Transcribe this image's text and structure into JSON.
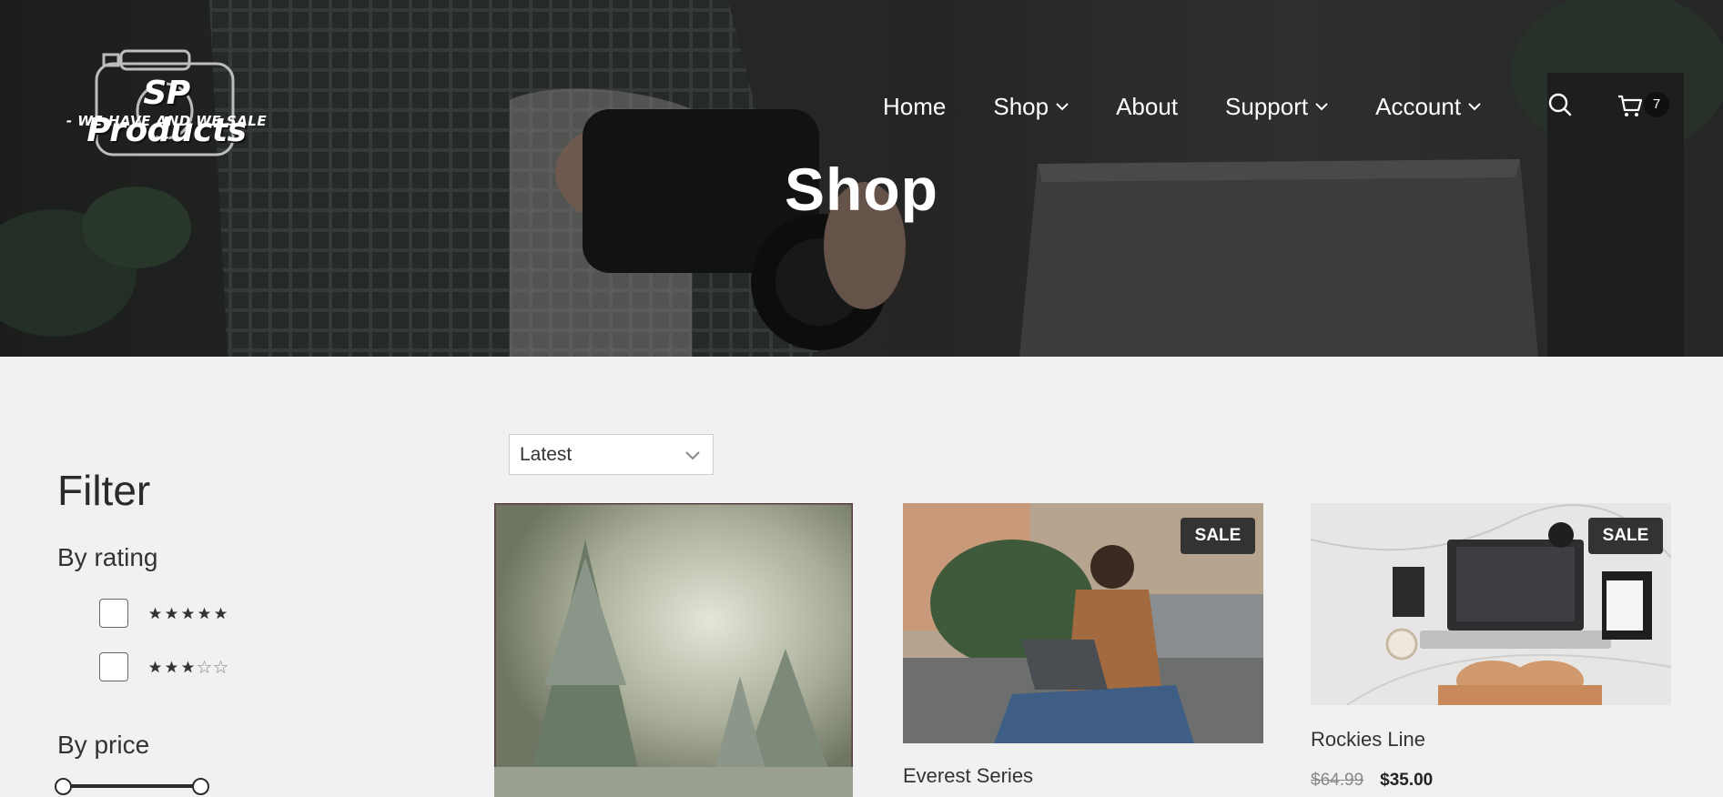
{
  "brand": {
    "name": "SP Products",
    "tagline": "- WE HAVE AND WE SALE -",
    "logo_icon": "camera-outline-icon"
  },
  "nav": {
    "items": [
      {
        "label": "Home",
        "dropdown": false
      },
      {
        "label": "Shop",
        "dropdown": true
      },
      {
        "label": "About",
        "dropdown": false
      },
      {
        "label": "Support",
        "dropdown": true
      },
      {
        "label": "Account",
        "dropdown": true
      }
    ],
    "search_icon": "search-icon",
    "cart_icon": "cart-icon",
    "cart_count": "7"
  },
  "hero": {
    "title": "Shop"
  },
  "sidebar": {
    "title": "Filter",
    "by_rating": "By rating",
    "ratings": [
      {
        "stars": 5,
        "filled": 5,
        "checked": false
      },
      {
        "stars": 5,
        "filled": 3,
        "checked": false
      }
    ],
    "by_price": "By price",
    "price_range": {
      "min_fraction": 0,
      "max_fraction": 1
    }
  },
  "sort": {
    "selected": "Latest"
  },
  "products": [
    {
      "name": "",
      "sale": false,
      "old_price": "",
      "price": ""
    },
    {
      "name": "Everest Series",
      "sale": true,
      "sale_label": "SALE",
      "old_price": "",
      "price": ""
    },
    {
      "name": "Rockies Line",
      "sale": true,
      "sale_label": "SALE",
      "old_price": "$64.99",
      "price": "$35.00"
    }
  ],
  "colors": {
    "page_bg": "#f1f1f1",
    "badge_bg": "#333333",
    "text": "#2b2b2b"
  }
}
